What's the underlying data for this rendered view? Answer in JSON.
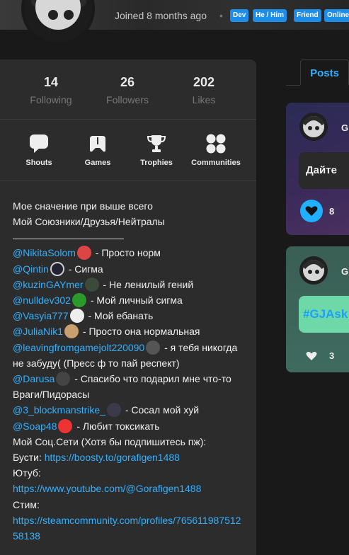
{
  "header": {
    "joined": "Joined 8 months ago",
    "separator": "•",
    "tags": [
      "Dev",
      "He / Him",
      "Friend",
      "Online"
    ]
  },
  "stats": [
    {
      "value": "14",
      "label": "Following"
    },
    {
      "value": "26",
      "label": "Followers"
    },
    {
      "value": "202",
      "label": "Likes"
    }
  ],
  "nav": [
    {
      "label": "Shouts",
      "icon": "chat-bubble-icon"
    },
    {
      "label": "Games",
      "icon": "gamepad-icon"
    },
    {
      "label": "Trophies",
      "icon": "trophy-icon"
    },
    {
      "label": "Communities",
      "icon": "communities-icon"
    }
  ],
  "bio": {
    "line1": "Мое сначение при выше всего",
    "line2": "Мой Союзники/Друзья/Нейтралы",
    "allies": [
      {
        "handle": "@NikitaSolom",
        "text": " - Просто норм"
      },
      {
        "handle": "@Qintin",
        "text": " - Сигма"
      },
      {
        "handle": "@kuzinGAYmer",
        "text": " - Не ленилый гений"
      },
      {
        "handle": "@nulldev302",
        "text": " - Мой личный сигма"
      },
      {
        "handle": "@Vasyia777",
        "text": " - Мой ебанать"
      },
      {
        "handle": "@JuliaNik1",
        "text": " - Просто она нормальная"
      },
      {
        "handle": "@leavingfromgamejolt220090",
        "text": " - я тебя никогда не забуду( (Пресс ф то пай респект)"
      },
      {
        "handle": "@Darusa",
        "text": " - Спасибо что подарил мне что-то"
      }
    ],
    "enemies_title": "Враги/Пидорасы",
    "enemies": [
      {
        "handle": "@3_blockmanstrike_",
        "text": " - Сосал мой хуй"
      },
      {
        "handle": "@Soap48",
        "text": " - Любит токсикать"
      }
    ],
    "socials_title": "Мой Соц.Сети (Хотя бы подпишитесь пж):",
    "boosty_label": "Бусти: ",
    "boosty_url": "https://boosty.to/gorafigen1488",
    "youtube_label": "Ютуб:",
    "youtube_url": "https://www.youtube.com/@Gorafigen1488",
    "steam_label": "Стим:",
    "steam_url": "https://steamcommunity.com/profiles/76561198751258138"
  },
  "tabs": {
    "posts": "Posts"
  },
  "posts": [
    {
      "author_initial": "G",
      "text": "Дайте",
      "likes": "8",
      "liked": true
    },
    {
      "author_initial": "G",
      "text": "#GJAsk",
      "likes": "3",
      "liked": false
    }
  ],
  "colors": {
    "accent": "#33b0ff",
    "tag": "#1c8ee9",
    "card": "#2c2c2c",
    "bg": "#191919"
  }
}
